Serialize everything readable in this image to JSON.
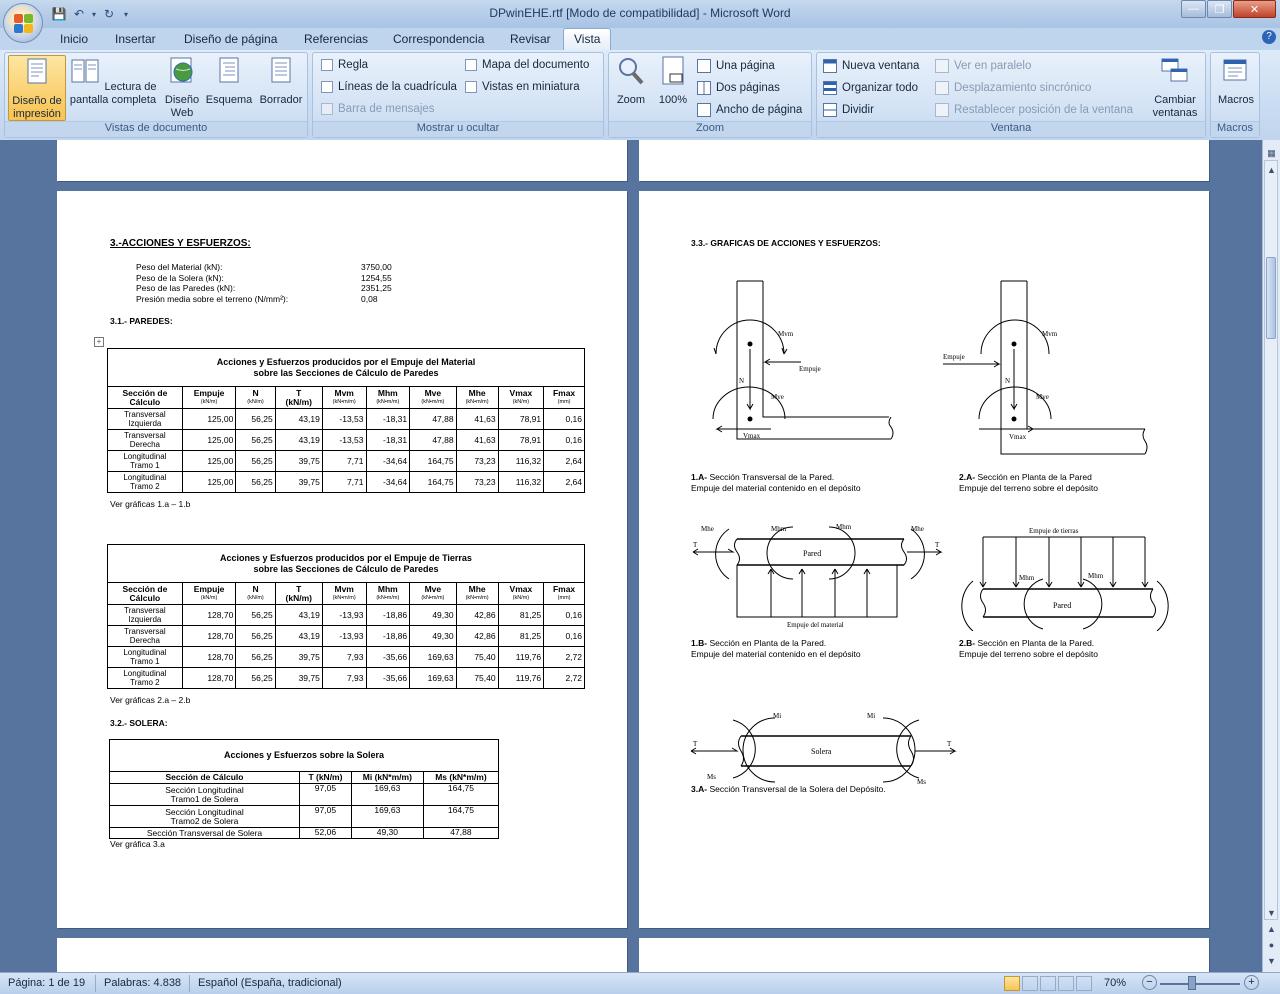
{
  "window": {
    "title": "DPwinEHE.rtf [Modo de compatibilidad] - Microsoft Word",
    "controls": [
      "minimize",
      "restore",
      "close"
    ]
  },
  "tabs": [
    "Inicio",
    "Insertar",
    "Diseño de página",
    "Referencias",
    "Correspondencia",
    "Revisar",
    "Vista"
  ],
  "active_tab": "Vista",
  "ribbon": {
    "vistas": {
      "label": "Vistas de documento",
      "buttons": [
        "Diseño de impresión",
        "Lectura de pantalla completa",
        "Diseño Web",
        "Esquema",
        "Borrador"
      ]
    },
    "mostrar": {
      "label": "Mostrar u ocultar",
      "items": [
        "Regla",
        "Líneas de la cuadrícula",
        "Barra de mensajes",
        "Mapa del documento",
        "Vistas en miniatura"
      ]
    },
    "zoom": {
      "label": "Zoom",
      "zoom": "Zoom",
      "pct": "100%",
      "items": [
        "Una página",
        "Dos páginas",
        "Ancho de página"
      ]
    },
    "ventana": {
      "label": "Ventana",
      "items": [
        "Nueva ventana",
        "Organizar todo",
        "Dividir",
        "Ver en paralelo",
        "Desplazamiento sincrónico",
        "Restablecer posición de la ventana"
      ],
      "cambiar": "Cambiar ventanas"
    },
    "macros": {
      "label": "Macros",
      "button": "Macros"
    }
  },
  "doc": {
    "heading": "3.-ACCIONES Y ESFUERZOS:",
    "summary": [
      {
        "label": "Peso del Material (kN):",
        "value": "3750,00"
      },
      {
        "label": "Peso de la Solera (kN):",
        "value": "1254,55"
      },
      {
        "label": "Peso de las Paredes (kN):",
        "value": "2351,25"
      },
      {
        "label": "Presión media sobre el terreno (N/mm²):",
        "value": "0,08"
      }
    ],
    "sec31": "3.1.- PAREDES:",
    "t1": {
      "title1": "Acciones y Esfuerzos producidos por el Empuje del Material",
      "title2": "sobre las Secciones de Cálculo de Paredes",
      "rows": [
        [
          "Transversal",
          "Izquierda",
          "125,00",
          "56,25",
          "43,19",
          "-13,53",
          "-18,31",
          "47,88",
          "41,63",
          "78,91",
          "0,16"
        ],
        [
          "Transversal",
          "Derecha",
          "125,00",
          "56,25",
          "43,19",
          "-13,53",
          "-18,31",
          "47,88",
          "41,63",
          "78,91",
          "0,16"
        ],
        [
          "Longitudinal",
          "Tramo 1",
          "125,00",
          "56,25",
          "39,75",
          "7,71",
          "-34,64",
          "164,75",
          "73,23",
          "116,32",
          "2,64"
        ],
        [
          "Longitudinal",
          "Tramo 2",
          "125,00",
          "56,25",
          "39,75",
          "7,71",
          "-34,64",
          "164,75",
          "73,23",
          "116,32",
          "2,64"
        ]
      ],
      "note": "Ver gráficas 1.a – 1.b"
    },
    "t2": {
      "title1": "Acciones y Esfuerzos producidos por el Empuje de Tierras",
      "title2": "sobre las Secciones de Cálculo de Paredes",
      "rows": [
        [
          "Transversal",
          "Izquierda",
          "128,70",
          "56,25",
          "43,19",
          "-13,93",
          "-18,86",
          "49,30",
          "42,86",
          "81,25",
          "0,16"
        ],
        [
          "Transversal",
          "Derecha",
          "128,70",
          "56,25",
          "43,19",
          "-13,93",
          "-18,86",
          "49,30",
          "42,86",
          "81,25",
          "0,16"
        ],
        [
          "Longitudinal",
          "Tramo 1",
          "128,70",
          "56,25",
          "39,75",
          "7,93",
          "-35,66",
          "169,63",
          "75,40",
          "119,76",
          "2,72"
        ],
        [
          "Longitudinal",
          "Tramo 2",
          "128,70",
          "56,25",
          "39,75",
          "7,93",
          "-35,66",
          "169,63",
          "75,40",
          "119,76",
          "2,72"
        ]
      ],
      "note": "Ver gráficas 2.a – 2.b"
    },
    "cols": [
      [
        "Sección de",
        "Cálculo",
        ""
      ],
      [
        "Empuje",
        "",
        "(kN/m)"
      ],
      [
        "N",
        "",
        "(kN/m)"
      ],
      [
        "T",
        "(kN/m)",
        ""
      ],
      [
        "Mvm",
        "",
        "(kN•m/m)"
      ],
      [
        "Mhm",
        "",
        "(kN•m/m)"
      ],
      [
        "Mve",
        "",
        "(kN•m/m)"
      ],
      [
        "Mhe",
        "",
        "(kN•m/m)"
      ],
      [
        "Vmax",
        "",
        "(kN/m)"
      ],
      [
        "Fmax",
        "",
        "(mm)"
      ]
    ],
    "sec32": "3.2.- SOLERA:",
    "t3": {
      "title": "Acciones y Esfuerzos sobre la Solera",
      "cols": [
        "Sección de Cálculo",
        "T (kN/m)",
        "Mi (kN*m/m)",
        "Ms (kN*m/m)"
      ],
      "rows": [
        [
          "Sección Longitudinal",
          "Tramo1 de Solera",
          "97,05",
          "169,63",
          "164,75"
        ],
        [
          "Sección Longitudinal",
          "Tramo2 de Solera",
          "97,05",
          "169,63",
          "164,75"
        ],
        [
          "Sección Transversal de Solera",
          "",
          "52,06",
          "49,30",
          "47,88"
        ]
      ],
      "note": "Ver gráfica 3.a"
    },
    "sec33": "3.3.- GRAFICAS DE ACCIONES Y ESFUERZOS:",
    "fig1a": {
      "num": "1.A-",
      "t1": "Sección Transversal de la Pared.",
      "t2": "Empuje del material contenido en el depósito"
    },
    "fig2a": {
      "num": "2.A-",
      "t1": "Sección en Planta de la Pared",
      "t2": "Empuje del terreno sobre el depósito"
    },
    "fig1b": {
      "num": "1.B-",
      "t1": "Sección en Planta de la Pared.",
      "t2": "Empuje del material contenido en el depósito"
    },
    "fig2b": {
      "num": "2.B-",
      "t1": "Sección en Planta de la Pared.",
      "t2": "Empuje del terreno sobre el depósito"
    },
    "fig3a": {
      "num": "3.A-",
      "t1": "Sección Transversal de la Solera del Depósito."
    },
    "labels": {
      "mvm": "Mvm",
      "mve": "Mve",
      "empuje": "Empuje",
      "n": "N",
      "vmax": "Vmax",
      "mhe": "Mhe",
      "mhm": "Mhm",
      "t": "T",
      "pared": "Pared",
      "empmat": "Empuje del material",
      "emptie": "Empuje de tierras",
      "mi": "Mi",
      "ms": "Ms",
      "solera": "Solera"
    }
  },
  "status": {
    "page": "Página: 1 de 19",
    "words": "Palabras: 4.838",
    "lang": "Español (España, tradicional)",
    "zoom": "70%"
  }
}
